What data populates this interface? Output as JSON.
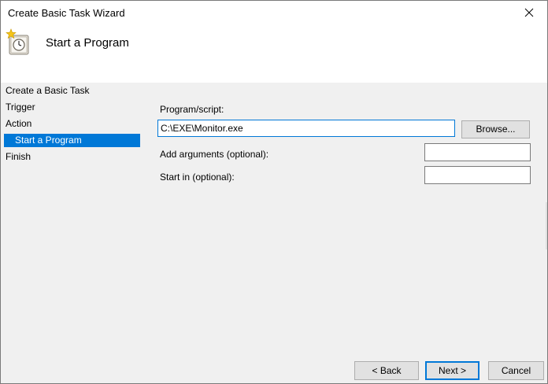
{
  "window": {
    "title": "Create Basic Task Wizard"
  },
  "header": {
    "title": "Start a Program",
    "icon": "task-scheduler-clock-icon"
  },
  "nav": {
    "items": [
      {
        "label": "Create a Basic Task"
      },
      {
        "label": "Trigger"
      },
      {
        "label": "Action"
      },
      {
        "label": "Start a Program"
      },
      {
        "label": "Finish"
      }
    ],
    "selected": "Start a Program"
  },
  "form": {
    "program_label": "Program/script:",
    "program_value": "C:\\EXE\\Monitor.exe",
    "browse_label": "Browse...",
    "arguments_label": "Add arguments (optional):",
    "arguments_value": "",
    "startin_label": "Start in (optional):",
    "startin_value": ""
  },
  "footer": {
    "back_label": "< Back",
    "next_label": "Next >",
    "cancel_label": "Cancel"
  },
  "colors": {
    "selection": "#0078d7",
    "background": "#f0f0f0",
    "header_bg": "#ffffff"
  }
}
